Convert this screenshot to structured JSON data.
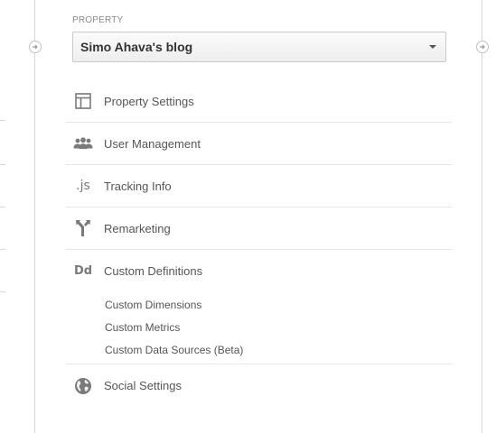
{
  "property": {
    "label": "PROPERTY",
    "selected": "Simo Ahava's blog"
  },
  "menu": {
    "items": [
      {
        "label": "Property Settings",
        "icon": "layout-icon"
      },
      {
        "label": "User Management",
        "icon": "users-icon"
      },
      {
        "label": "Tracking Info",
        "icon": "js-icon",
        "icon_text": ".js"
      },
      {
        "label": "Remarketing",
        "icon": "fork-icon"
      },
      {
        "label": "Custom Definitions",
        "icon": "dd-icon",
        "icon_text": "Dd",
        "subitems": [
          "Custom Dimensions",
          "Custom Metrics",
          "Custom Data Sources (Beta)"
        ]
      },
      {
        "label": "Social Settings",
        "icon": "globe-icon"
      }
    ]
  },
  "colors": {
    "line": "#d6d6d6",
    "icon": "#7a7a7a",
    "text": "#555555"
  }
}
